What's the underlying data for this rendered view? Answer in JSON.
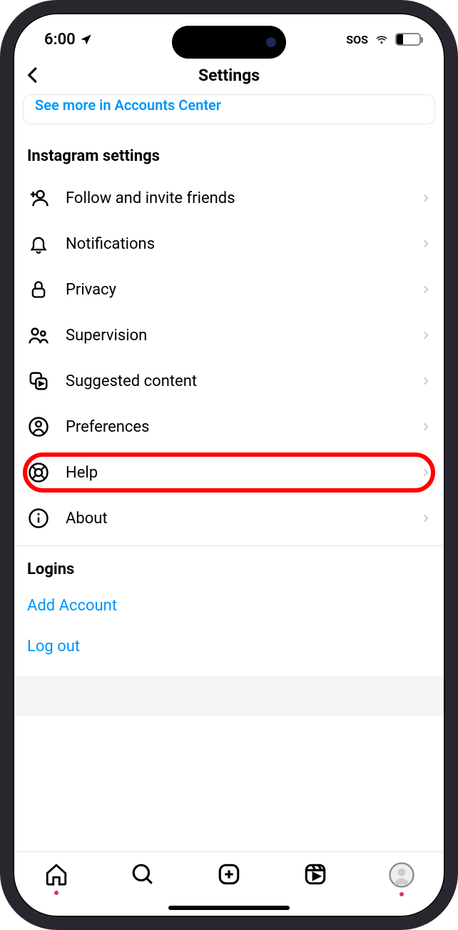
{
  "status": {
    "time": "6:00",
    "sos": "SOS",
    "battery_pct": "27"
  },
  "header": {
    "title": "Settings"
  },
  "accounts_center": {
    "link": "See more in Accounts Center"
  },
  "settings_section": {
    "title": "Instagram settings",
    "items": [
      {
        "label": "Follow and invite friends"
      },
      {
        "label": "Notifications"
      },
      {
        "label": "Privacy"
      },
      {
        "label": "Supervision"
      },
      {
        "label": "Suggested content"
      },
      {
        "label": "Preferences"
      },
      {
        "label": "Help"
      },
      {
        "label": "About"
      }
    ]
  },
  "logins": {
    "title": "Logins",
    "add": "Add Account",
    "logout": "Log out"
  }
}
